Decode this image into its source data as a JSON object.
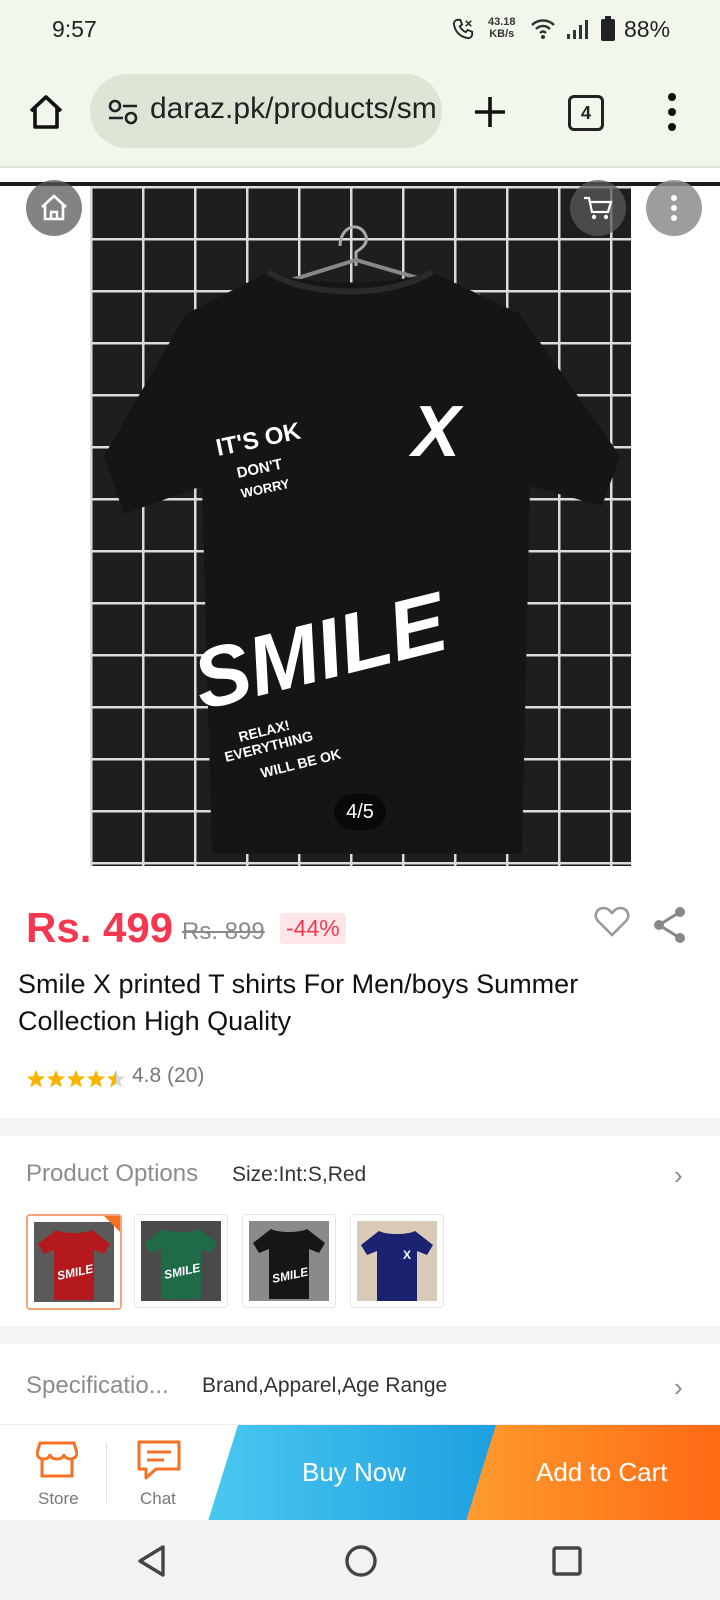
{
  "status_bar": {
    "time": "9:57",
    "net_speed_value": "43.18",
    "net_speed_unit": "KB/s",
    "battery": "88%"
  },
  "browser": {
    "url": "daraz.pk/products/sm",
    "tab_count": "4"
  },
  "gallery": {
    "counter": "4/5"
  },
  "product": {
    "price": "Rs. 499",
    "old_price": "Rs. 899",
    "discount": "-44%",
    "title": "Smile X printed T shirts For Men/boys Summer Collection High Quality",
    "rating_value": 4.8,
    "rating_text": "4.8 (20)",
    "stars_filled": 4.5
  },
  "options": {
    "label": "Product Options",
    "value": "Size:Int:S,Red",
    "variants": [
      {
        "name": "red",
        "color": "#b3191d"
      },
      {
        "name": "green",
        "color": "#1f6b47"
      },
      {
        "name": "black",
        "color": "#161616"
      },
      {
        "name": "navy",
        "color": "#1c2272"
      }
    ]
  },
  "specification": {
    "label": "Specificatio...",
    "value": "Brand,Apparel,Age Range"
  },
  "actions": {
    "store_label": "Store",
    "chat_label": "Chat",
    "buy_now_label": "Buy Now",
    "add_to_cart_label": "Add to Cart"
  },
  "print_text": {
    "line1": "IT'S OK",
    "line2": "DON'T",
    "line3": "WORRY",
    "x_mark": "X",
    "smile": "SMILE",
    "sub1": "RELAX!",
    "sub2": "EVERYTHING",
    "sub3": "WILL BE OK"
  },
  "colors": {
    "accent_price": "#f5374f",
    "store_orange": "#f57224",
    "buy_blue": "#1e9fe0",
    "cart_orange": "#ff6a14"
  }
}
